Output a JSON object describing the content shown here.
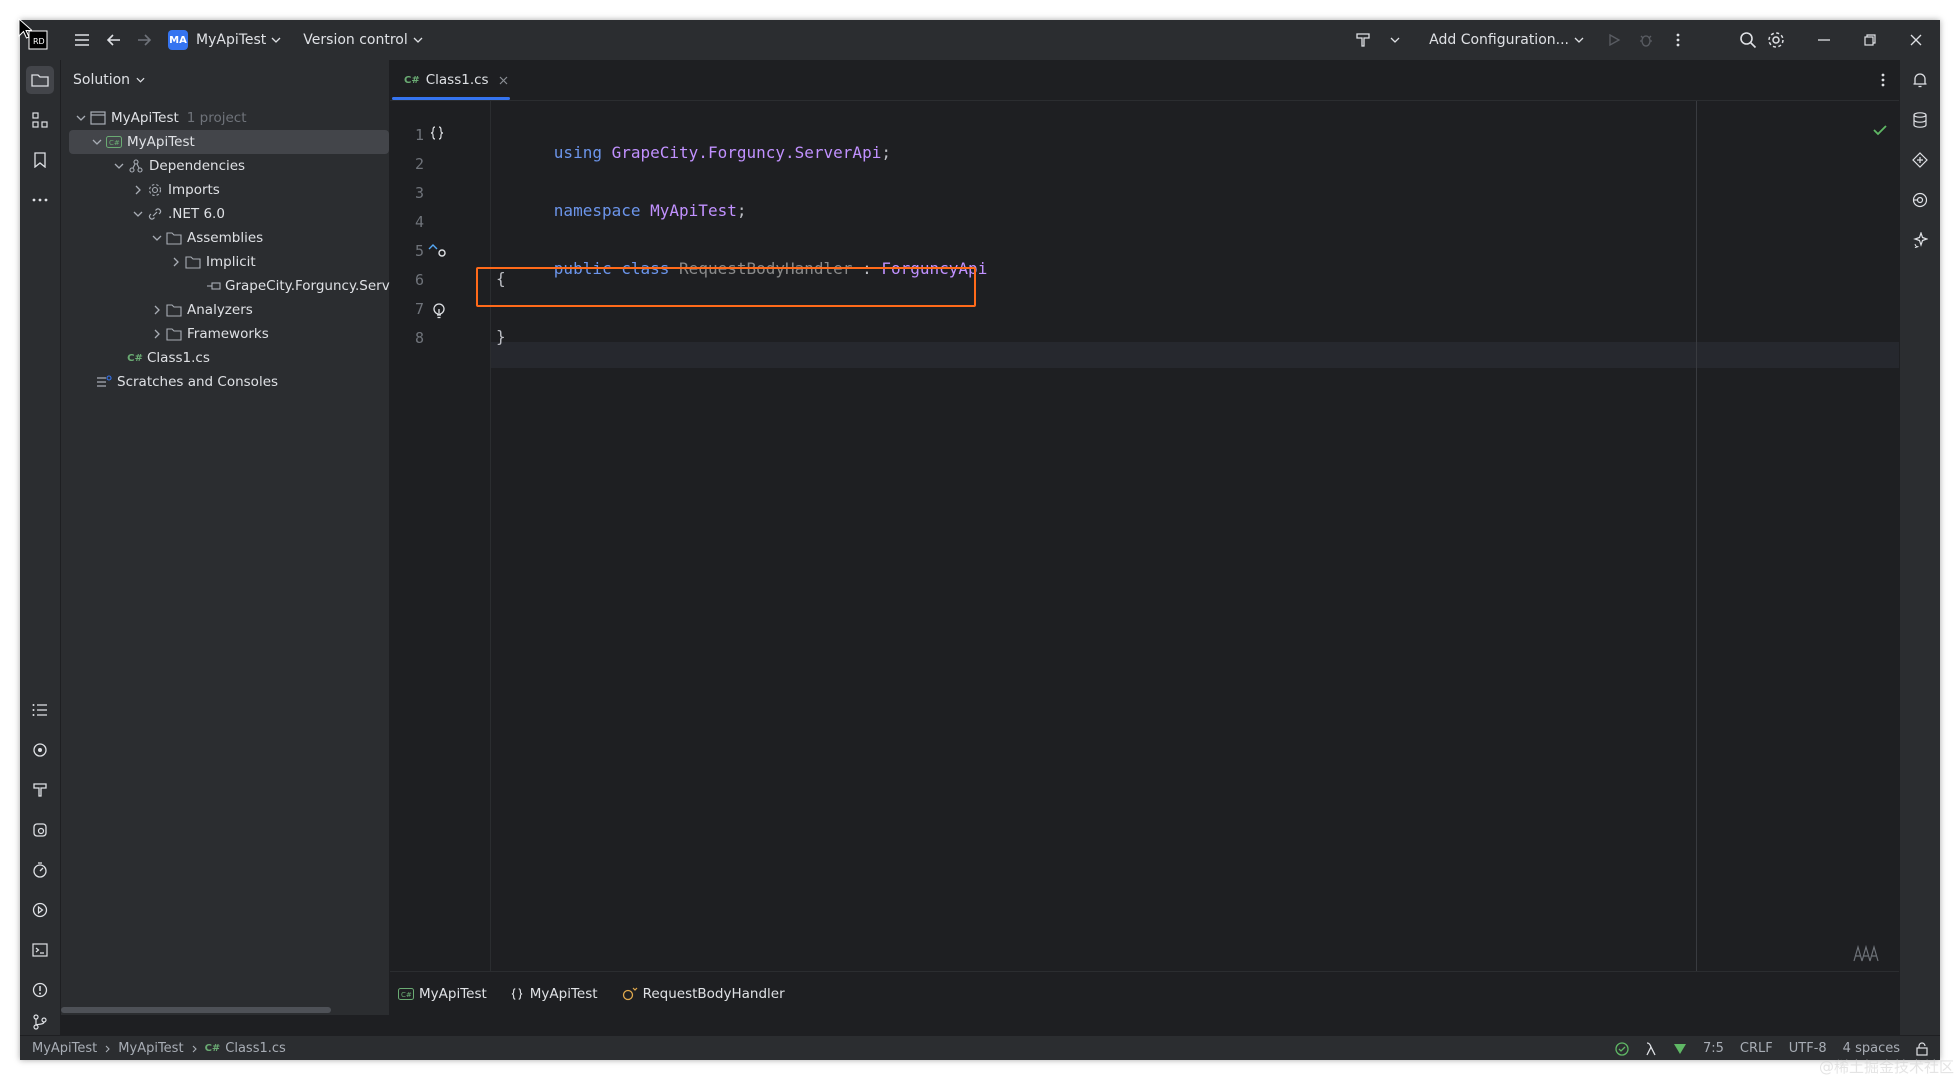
{
  "titlebar": {
    "project_badge": "MA",
    "project_name": "MyApiTest",
    "version_control": "Version control",
    "run_config": "Add Configuration..."
  },
  "solution_panel": {
    "title": "Solution",
    "tree": [
      {
        "label": "MyApiTest",
        "note": "1 project"
      },
      {
        "label": "MyApiTest"
      },
      {
        "label": "Dependencies"
      },
      {
        "label": "Imports"
      },
      {
        "label": ".NET 6.0"
      },
      {
        "label": "Assemblies"
      },
      {
        "label": "Implicit"
      },
      {
        "label": "GrapeCity.Forguncy.Serve"
      },
      {
        "label": "Analyzers"
      },
      {
        "label": "Frameworks"
      },
      {
        "label": "Class1.cs"
      },
      {
        "label": "Scratches and Consoles"
      }
    ]
  },
  "editor": {
    "tab_label": "Class1.cs",
    "tab_lang": "C#",
    "line_numbers": [
      "1",
      "2",
      "3",
      "4",
      "5",
      "6",
      "7",
      "8"
    ],
    "code": {
      "l1_kw": "using",
      "l1_ns": "GrapeCity.Forguncy.ServerApi",
      "l1_end": ";",
      "l3_kw": "namespace",
      "l3_ns": "MyApiTest",
      "l3_end": ";",
      "l5_kw1": "public",
      "l5_kw2": "class",
      "l5_cls": "RequestBodyHandler",
      "l5_colon": ":",
      "l5_base": "ForguncyApi",
      "l6": "{",
      "l8": "}"
    },
    "breadcrumb": [
      "MyApiTest",
      "MyApiTest",
      "RequestBodyHandler"
    ]
  },
  "statusbar": {
    "path": [
      "MyApiTest",
      "MyApiTest",
      "Class1.cs"
    ],
    "position": "7:5",
    "line_ending": "CRLF",
    "encoding": "UTF-8",
    "indent": "4 spaces"
  },
  "watermark": "@稀土掘金技术社区",
  "colors": {
    "accent": "#3574f0",
    "highlight_box": "#ff6a1a",
    "keyword": "#6c95eb",
    "namespace": "#c191ff"
  }
}
